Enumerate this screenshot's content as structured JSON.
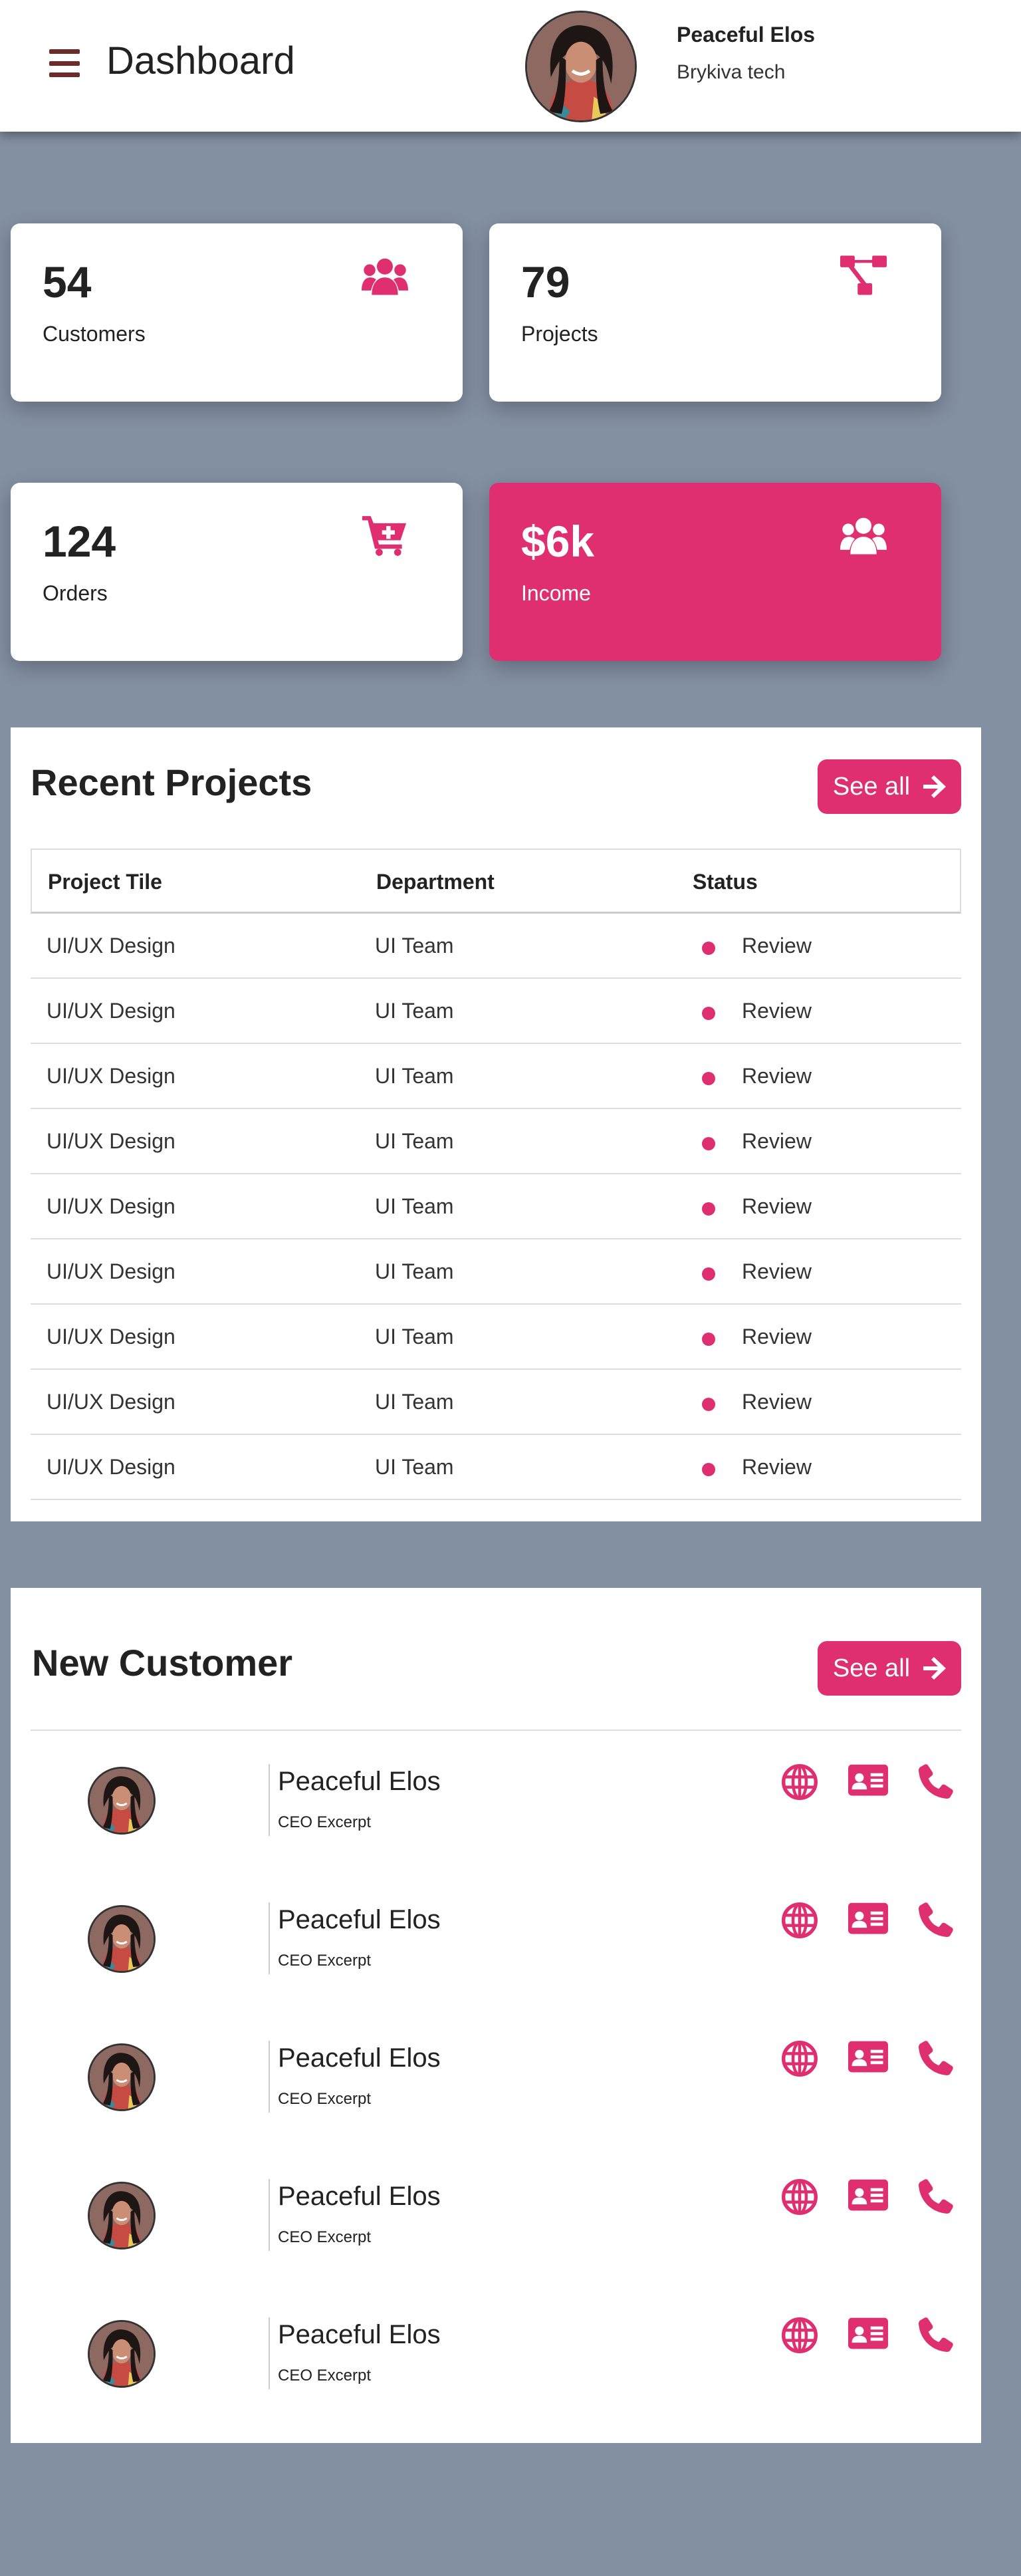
{
  "header": {
    "title": "Dashboard",
    "user_name": "Peaceful Elos",
    "user_company": "Brykiva tech"
  },
  "cards": [
    {
      "value": "54",
      "label": "Customers",
      "icon": "users-icon"
    },
    {
      "value": "79",
      "label": "Projects",
      "icon": "project-diagram-icon"
    },
    {
      "value": "124",
      "label": "Orders",
      "icon": "cart-plus-icon"
    },
    {
      "value": "$6k",
      "label": "Income",
      "icon": "users-icon"
    }
  ],
  "recent_projects": {
    "title": "Recent Projects",
    "see_all": "See all",
    "columns": [
      "Project Tile",
      "Department",
      "Status"
    ],
    "rows": [
      [
        "UI/UX Design",
        "UI Team",
        "Review"
      ],
      [
        "UI/UX Design",
        "UI Team",
        "Review"
      ],
      [
        "UI/UX Design",
        "UI Team",
        "Review"
      ],
      [
        "UI/UX Design",
        "UI Team",
        "Review"
      ],
      [
        "UI/UX Design",
        "UI Team",
        "Review"
      ],
      [
        "UI/UX Design",
        "UI Team",
        "Review"
      ],
      [
        "UI/UX Design",
        "UI Team",
        "Review"
      ],
      [
        "UI/UX Design",
        "UI Team",
        "Review"
      ],
      [
        "UI/UX Design",
        "UI Team",
        "Review"
      ]
    ]
  },
  "new_customer": {
    "title": "New Customer",
    "see_all": "See all",
    "items": [
      {
        "name": "Peaceful Elos",
        "role": "CEO Excerpt"
      },
      {
        "name": "Peaceful Elos",
        "role": "CEO Excerpt"
      },
      {
        "name": "Peaceful Elos",
        "role": "CEO Excerpt"
      },
      {
        "name": "Peaceful Elos",
        "role": "CEO Excerpt"
      },
      {
        "name": "Peaceful Elos",
        "role": "CEO Excerpt"
      }
    ],
    "action_icons": [
      "globe-icon",
      "id-card-icon",
      "phone-icon"
    ]
  },
  "colors": {
    "accent": "#df2f70",
    "background": "#8390a2",
    "menu_icon": "#6b2b2b"
  }
}
